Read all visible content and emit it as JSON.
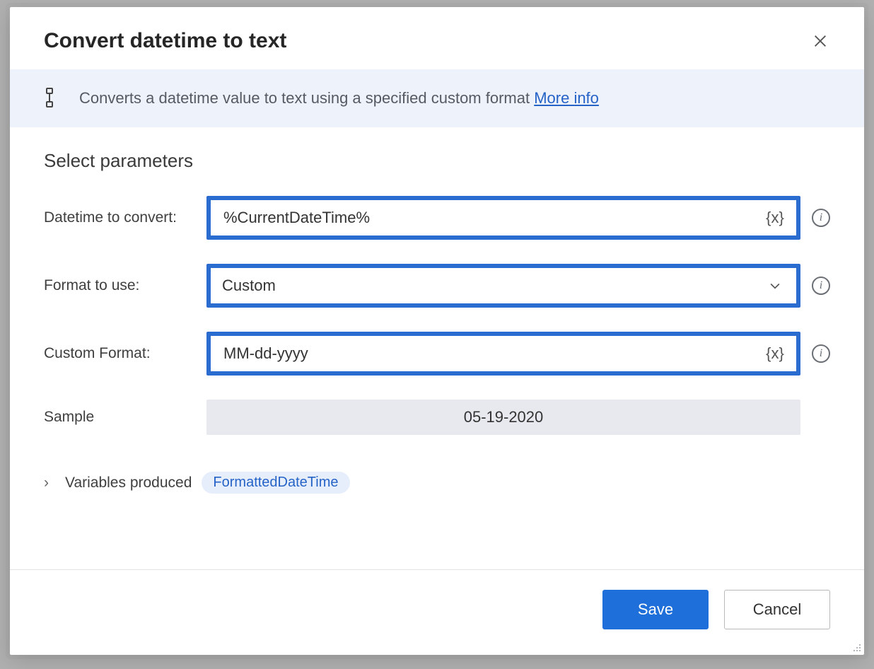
{
  "dialog": {
    "title": "Convert datetime to text",
    "description_text": "Converts a datetime value to text using a specified custom format ",
    "more_info_label": "More info",
    "section_title": "Select parameters",
    "close_glyph": "✕"
  },
  "params": {
    "datetime_label": "Datetime to convert:",
    "datetime_value": "%CurrentDateTime%",
    "format_label": "Format to use:",
    "format_value": "Custom",
    "custom_label": "Custom Format:",
    "custom_value": "MM-dd-yyyy",
    "sample_label": "Sample",
    "sample_value": "05-19-2020",
    "var_picker_glyph": "{x}"
  },
  "variables": {
    "section_label": "Variables produced",
    "chip": "FormattedDateTime",
    "chevron": "›"
  },
  "footer": {
    "save_label": "Save",
    "cancel_label": "Cancel"
  },
  "info_glyph": "i"
}
